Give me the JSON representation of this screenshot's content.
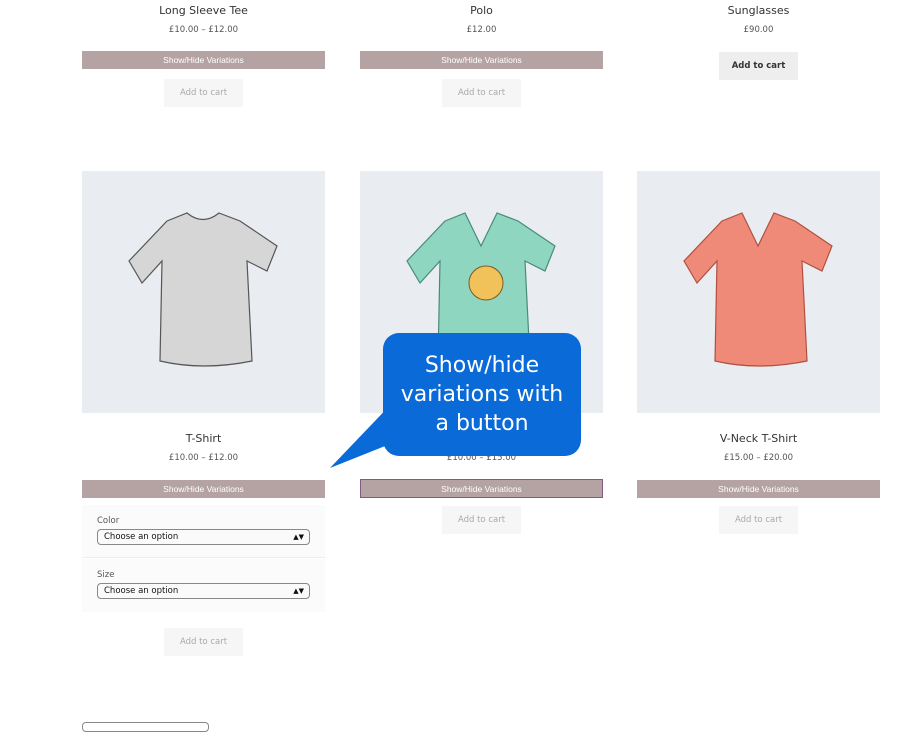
{
  "products_row1": [
    {
      "title": "Long Sleeve Tee",
      "price": "£10.00 – £12.00",
      "toggle": "Show/Hide Variations",
      "cart": "Add to cart"
    },
    {
      "title": "Polo",
      "price": "£12.00",
      "toggle": "Show/Hide Variations",
      "cart": "Add to cart"
    },
    {
      "title": "Sunglasses",
      "price": "£90.00",
      "cart": "Add to cart"
    }
  ],
  "products_row2": [
    {
      "title": "T-Shirt",
      "price": "£10.00 – £12.00",
      "toggle": "Show/Hide Variations",
      "cart": "Add to cart",
      "shirt_color": "#d6d6d6",
      "variations": [
        {
          "label": "Color",
          "value": "Choose an option"
        },
        {
          "label": "Size",
          "value": "Choose an option"
        }
      ]
    },
    {
      "title": "",
      "price": "£10.00 – £15.00",
      "toggle": "Show/Hide Variations",
      "cart": "Add to cart",
      "shirt_color": "#8fd6c0"
    },
    {
      "title": "V-Neck T-Shirt",
      "price": "£15.00 – £20.00",
      "toggle": "Show/Hide Variations",
      "cart": "Add to cart",
      "shirt_color": "#f08a78"
    }
  ],
  "callout": {
    "line1": "Show/hide",
    "line2": "variations with",
    "line3": "a button",
    "color": "#0a6ad8"
  },
  "colors": {
    "toggle_bg": "#b5a3a3",
    "image_bg": "#e9edf1"
  }
}
